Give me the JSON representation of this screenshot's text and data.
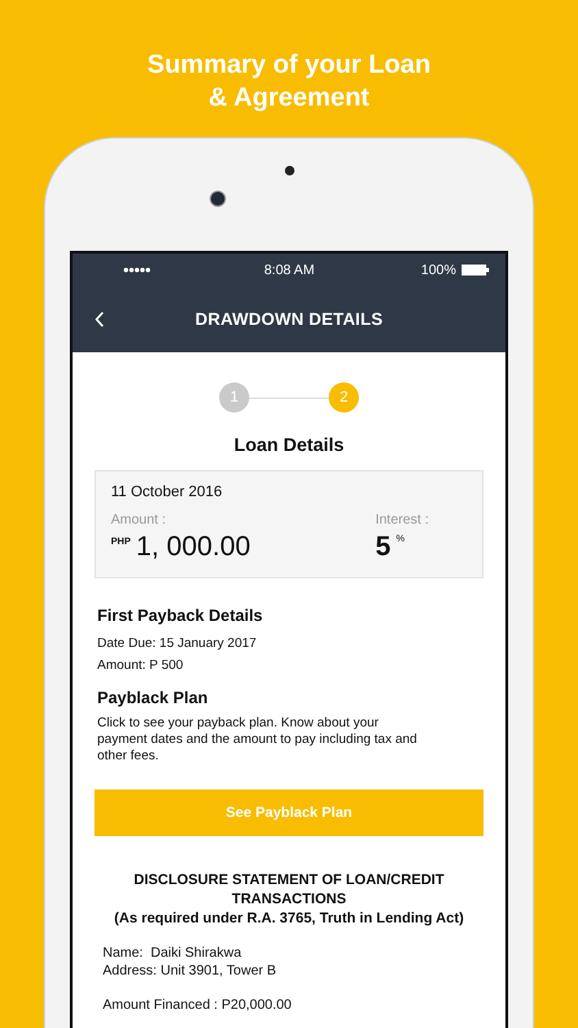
{
  "headline": [
    "Summary of your Loan",
    "& Agreement"
  ],
  "status_bar": {
    "time": "8:08 AM",
    "battery": "100%"
  },
  "nav": {
    "title": "DRAWDOWN DETAILS"
  },
  "steps": [
    {
      "label": "1",
      "selected": false
    },
    {
      "label": "2",
      "selected": true
    }
  ],
  "section_title": "Loan Details",
  "card": {
    "date": "11 October 2016",
    "amount_label": "Amount :",
    "currency": "PHP",
    "amount": "1, 000.00",
    "interest_label": "Interest :",
    "interest": "5",
    "interest_unit": "%"
  },
  "first_payback": {
    "title": "First Payback Details",
    "lines": [
      "Date Due: 15 January 2017",
      "Amount: P 500"
    ]
  },
  "plan": {
    "title": "Payblack Plan",
    "description": "Click to see your payback plan. Know about your payment dates and the amount to pay including tax and other fees.",
    "button": "See Payblack Plan"
  },
  "disclosure": {
    "title": "DISCLOSURE STATEMENT OF LOAN/CREDIT TRANSACTIONS",
    "subtitle": "(As required under R.A. 3765, Truth in Lending Act)",
    "lines": [
      "Name:  Daiki Shirakwa",
      "Address: Unit 3901, Tower B"
    ],
    "amount_financed": "Amount Financed : P20,000.00"
  }
}
